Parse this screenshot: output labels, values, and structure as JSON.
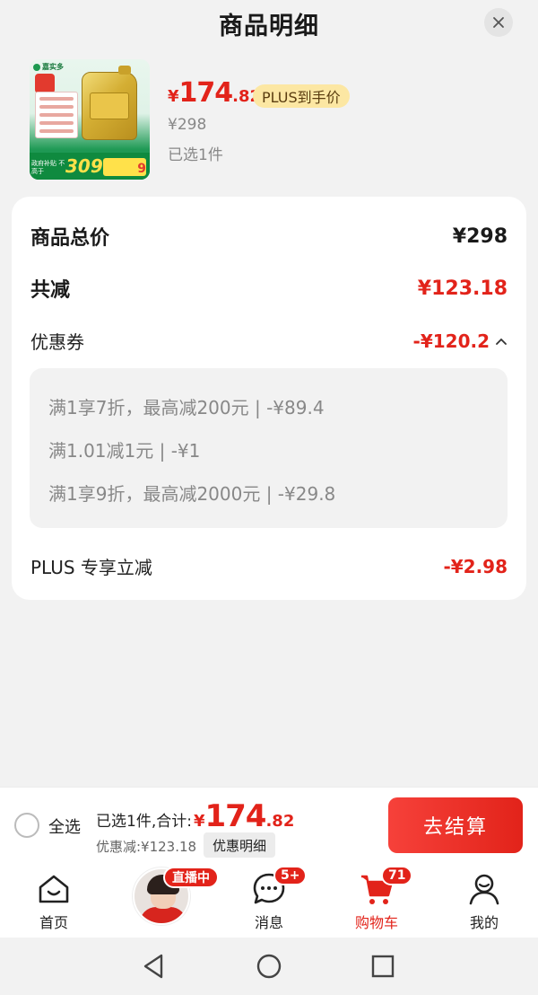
{
  "header": {
    "title": "商品明细",
    "close_icon": "close-icon"
  },
  "product": {
    "thumb_brand": "嘉实多",
    "thumb_promo_text": "政府补贴 不高于",
    "thumb_promo_number": "309元",
    "thumb_promo_right": "9",
    "price_currency": "¥",
    "price_int": "174",
    "price_dec": ".82",
    "plus_tag": "PLUS到手价",
    "original_price": "¥298",
    "selected_count": "已选1件"
  },
  "summary": {
    "total_label": "商品总价",
    "total_value": "¥298",
    "reduce_label": "共减",
    "reduce_value": "¥123.18",
    "coupon_label": "优惠券",
    "coupon_value": "-¥120.2",
    "coupons": [
      "满1享7折，最高减200元 | -¥89.4",
      "满1.01减1元 | -¥1",
      "满1享9折，最高减2000元 | -¥29.8"
    ],
    "plus_label": "PLUS 专享立减",
    "plus_value": "-¥2.98"
  },
  "checkout": {
    "select_all": "全选",
    "total_prefix": "已选1件,合计:",
    "total_currency": "¥",
    "total_int": "174",
    "total_dec": ".82",
    "discount_text": "优惠减:¥123.18",
    "detail_button": "优惠明细",
    "checkout_button": "去结算"
  },
  "tabbar": {
    "tabs": [
      {
        "label": "首页",
        "icon": "home-icon"
      },
      {
        "label": "",
        "icon": "live-avatar"
      },
      {
        "label": "消息",
        "icon": "message-icon",
        "badge": "5+"
      },
      {
        "label": "购物车",
        "icon": "cart-icon",
        "badge": "71",
        "active": true
      },
      {
        "label": "我的",
        "icon": "profile-icon"
      }
    ],
    "live_tag": "直播中"
  },
  "colors": {
    "accent": "#e2231a",
    "plus_tag_bg": "#fce7a3",
    "background": "#f2f2f2"
  }
}
